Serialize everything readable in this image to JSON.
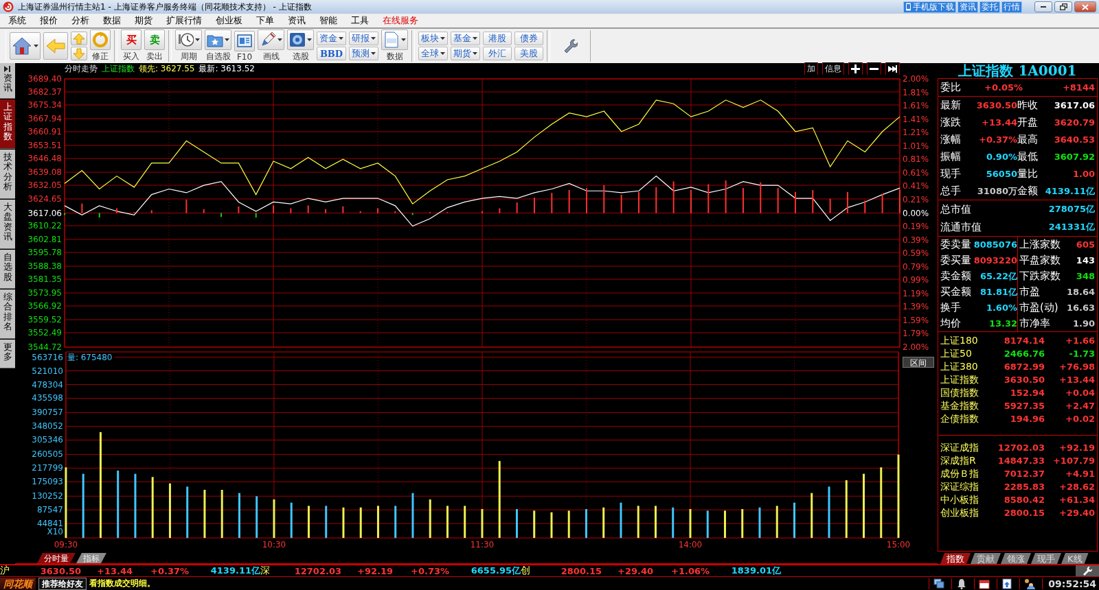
{
  "window": {
    "title": "上海证券温州行情主站1 - 上海证券客户服务终端（同花顺技术支持） - 上证指数",
    "links": [
      "手机版下载",
      "资讯",
      "委托",
      "行情"
    ]
  },
  "menu": [
    {
      "label": "系统",
      "highlighted": false
    },
    {
      "label": "报价",
      "highlighted": false
    },
    {
      "label": "分析",
      "highlighted": false
    },
    {
      "label": "数据",
      "highlighted": false
    },
    {
      "label": "期货",
      "highlighted": false
    },
    {
      "label": "扩展行情",
      "highlighted": false
    },
    {
      "label": "创业板",
      "highlighted": false
    },
    {
      "label": "下单",
      "highlighted": false
    },
    {
      "label": "资讯",
      "highlighted": false
    },
    {
      "label": "智能",
      "highlighted": false
    },
    {
      "label": "工具",
      "highlighted": false
    },
    {
      "label": "在线服务",
      "highlighted": true
    }
  ],
  "toolbar": {
    "refresh_label": "修正",
    "trade": [
      {
        "glyph": "买",
        "label": "买入",
        "color": "#e00000"
      },
      {
        "glyph": "卖",
        "label": "卖出",
        "color": "#0a9a0a"
      }
    ],
    "tools": [
      {
        "label": "周期",
        "dropdown": true
      },
      {
        "label": "自选股",
        "dropdown": true
      },
      {
        "label": "F10",
        "dropdown": false
      },
      {
        "label": "画线",
        "dropdown": true
      },
      {
        "label": "选股",
        "dropdown": true
      }
    ],
    "quick": [
      [
        {
          "label": "资金",
          "dropdown": true,
          "bold": false
        },
        {
          "label": "BBD",
          "dropdown": false,
          "bold": true
        }
      ],
      [
        {
          "label": "研报",
          "dropdown": true,
          "bold": false
        },
        {
          "label": "预测",
          "dropdown": true,
          "bold": false
        }
      ]
    ],
    "data_tool": {
      "label": "数据",
      "dropdown": true
    },
    "markets": [
      [
        {
          "label": "板块",
          "dropdown": true
        },
        {
          "label": "全球",
          "dropdown": true
        }
      ],
      [
        {
          "label": "基金",
          "dropdown": true
        },
        {
          "label": "期货",
          "dropdown": true
        }
      ],
      [
        {
          "label": "港股",
          "dropdown": false
        },
        {
          "label": "外汇",
          "dropdown": false
        }
      ],
      [
        {
          "label": "债券",
          "dropdown": false
        },
        {
          "label": "美股",
          "dropdown": false
        }
      ]
    ]
  },
  "side_tabs": [
    {
      "label": "资讯",
      "selected": false
    },
    {
      "label": "上证指数",
      "selected": true
    },
    {
      "label": "技术分析",
      "selected": false
    },
    {
      "label": "大盘资讯",
      "selected": false
    },
    {
      "label": "自选股",
      "selected": false
    },
    {
      "label": "综合排名",
      "selected": false
    },
    {
      "label": "更多",
      "selected": false
    }
  ],
  "chart": {
    "header": {
      "view": "分时走势",
      "symbol": "上证指数",
      "lead": "领先: 3627.55",
      "latest": "最新: 3613.52",
      "buttons": [
        "加",
        "信息"
      ]
    },
    "right_yticks": [
      "2.00%",
      "1.81%",
      "1.61%",
      "1.41%",
      "1.21%",
      "1.01%",
      "0.81%",
      "0.61%",
      "0.41%",
      "0.21%",
      "0.00%",
      "0.19%",
      "0.39%",
      "0.59%",
      "0.79%",
      "0.99%",
      "1.19%",
      "1.39%",
      "1.59%",
      "1.79%",
      "2.00%"
    ],
    "range_button": "区间",
    "chart_data": {
      "type": "line",
      "grid": true,
      "series": [
        {
          "color": "#ffffff",
          "values": [
            3621,
            3616,
            3621,
            3618,
            3616,
            3627,
            3630,
            3628,
            3632,
            3634,
            3623,
            3618,
            3623,
            3622,
            3625,
            3623,
            3625,
            3625,
            3625,
            3621,
            3610,
            3614,
            3620,
            3623,
            3625,
            3626,
            3625,
            3628,
            3630,
            3633,
            3629,
            3629,
            3628,
            3629,
            3637,
            3629,
            3631,
            3628,
            3630,
            3634,
            3632,
            3632,
            3625,
            3625,
            3613,
            3620,
            3623,
            3627,
            3630.5
          ]
        },
        {
          "color": "#ffff40",
          "values": [
            3633,
            3640,
            3630,
            3637,
            3631,
            3644,
            3644,
            3656,
            3650,
            3644,
            3644,
            3627,
            3645,
            3641,
            3647,
            3641,
            3646,
            3641,
            3644,
            3637,
            3622,
            3629,
            3635,
            3637,
            3641,
            3645,
            3650,
            3658,
            3665,
            3671,
            3669,
            3672,
            3661,
            3665,
            3678,
            3676,
            3669,
            3672,
            3678,
            3674,
            3678,
            3672,
            3661,
            3663,
            3642,
            3656,
            3650,
            3661,
            3669
          ]
        }
      ],
      "ylim": [
        3544.72,
        3689.4
      ],
      "yticks": [
        {
          "value": 3689.4,
          "label": "3689.40"
        },
        {
          "value": 3682.37,
          "label": "3682.37"
        },
        {
          "value": 3675.34,
          "label": "3675.34"
        },
        {
          "value": 3667.94,
          "label": "3667.94"
        },
        {
          "value": 3660.91,
          "label": "3660.91"
        },
        {
          "value": 3653.51,
          "label": "3653.51"
        },
        {
          "value": 3646.48,
          "label": "3646.48"
        },
        {
          "value": 3639.08,
          "label": "3639.08"
        },
        {
          "value": 3632.05,
          "label": "3632.05"
        },
        {
          "value": 3624.65,
          "label": "3624.65"
        },
        {
          "value": 3617.06,
          "label": "3617.06"
        },
        {
          "value": 3610.22,
          "label": "3610.22"
        },
        {
          "value": 3602.81,
          "label": "3602.81"
        },
        {
          "value": 3595.78,
          "label": "3595.78"
        },
        {
          "value": 3588.38,
          "label": "3588.38"
        },
        {
          "value": 3581.35,
          "label": "3581.35"
        },
        {
          "value": 3573.95,
          "label": "3573.95"
        },
        {
          "value": 3566.92,
          "label": "3566.92"
        },
        {
          "value": 3559.52,
          "label": "3559.52"
        },
        {
          "value": 3552.49,
          "label": "3552.49"
        },
        {
          "value": 3544.72,
          "label": "3544.72"
        }
      ]
    },
    "volume": {
      "title": "量: 675480",
      "unit_label": "X10",
      "chart_data": {
        "type": "bar",
        "grid": true,
        "categories": [
          "09:30",
          null,
          null,
          null,
          null,
          null,
          null,
          null,
          null,
          null,
          null,
          null,
          "10:30",
          null,
          null,
          null,
          null,
          null,
          null,
          null,
          null,
          null,
          null,
          null,
          "11:30",
          null,
          null,
          null,
          null,
          null,
          null,
          null,
          null,
          null,
          null,
          null,
          "14:00",
          null,
          null,
          null,
          null,
          null,
          null,
          null,
          null,
          null,
          null,
          null,
          "15:00"
        ],
        "values": [
          220000,
          200000,
          330000,
          210000,
          200000,
          190000,
          170000,
          160000,
          150000,
          150000,
          140000,
          130000,
          120000,
          110000,
          100000,
          100000,
          95000,
          95000,
          100000,
          100000,
          140000,
          120000,
          100000,
          100000,
          90000,
          240000,
          90000,
          85000,
          80000,
          85000,
          90000,
          95000,
          110000,
          100000,
          100000,
          95000,
          90000,
          85000,
          85000,
          90000,
          95000,
          100000,
          110000,
          140000,
          160000,
          180000,
          200000,
          220000,
          260000
        ],
        "ylim": [
          0,
          580000
        ],
        "yticks": [
          563716,
          521010,
          478304,
          435598,
          390757,
          348052,
          305346,
          260505,
          217799,
          175093,
          130252,
          87547,
          44841
        ]
      }
    },
    "tabs": [
      {
        "label": "分时量",
        "selected": true
      },
      {
        "label": "指标",
        "selected": false
      }
    ]
  },
  "panel": {
    "title": "上证指数 1A0001",
    "commission": {
      "label": "委比",
      "ratio": "+0.05%",
      "diff": "+8144"
    },
    "quote": [
      {
        "cells": [
          {
            "label": "最新",
            "value": "3630.50",
            "color": "#ff3434"
          },
          {
            "label": "昨收",
            "value": "3617.06",
            "color": "#ffffff"
          }
        ]
      },
      {
        "cells": [
          {
            "label": "涨跌",
            "value": "+13.44",
            "color": "#ff3434"
          },
          {
            "label": "开盘",
            "value": "3620.79",
            "color": "#ff3434"
          }
        ]
      },
      {
        "cells": [
          {
            "label": "涨幅",
            "value": "+0.37%",
            "color": "#ff3434"
          },
          {
            "label": "最高",
            "value": "3640.53",
            "color": "#ff3434"
          }
        ]
      },
      {
        "cells": [
          {
            "label": "振幅",
            "value": "0.90%",
            "color": "#20d8ff"
          },
          {
            "label": "最低",
            "value": "3607.92",
            "color": "#10e010"
          }
        ]
      },
      {
        "cells": [
          {
            "label": "现手",
            "value": "56050",
            "color": "#20d8ff"
          },
          {
            "label": "量比",
            "value": "1.00",
            "color": "#ff3434"
          }
        ]
      },
      {
        "cells": [
          {
            "label": "总手",
            "value": "31080万",
            "color": "#c8c8c8"
          },
          {
            "label": "金额",
            "value": "4139.11亿",
            "color": "#20d8ff"
          }
        ]
      }
    ],
    "market_value": [
      {
        "label": "总市值",
        "value": "278075亿",
        "color": "#20d8ff"
      },
      {
        "label": "流通市值",
        "value": "241331亿",
        "color": "#20d8ff"
      }
    ],
    "orders": [
      {
        "cells": [
          {
            "label": "委卖量",
            "value": "8085076",
            "color": "#20d8ff"
          },
          {
            "label": "上涨家数",
            "value": "605",
            "color": "#ff3434"
          }
        ]
      },
      {
        "cells": [
          {
            "label": "委买量",
            "value": "8093220",
            "color": "#ff3434"
          },
          {
            "label": "平盘家数",
            "value": "143",
            "color": "#ffffff"
          }
        ]
      },
      {
        "cells": [
          {
            "label": "卖金额",
            "value": "65.22亿",
            "color": "#20d8ff"
          },
          {
            "label": "下跌家数",
            "value": "348",
            "color": "#10e010"
          }
        ]
      },
      {
        "cells": [
          {
            "label": "买金额",
            "value": "81.81亿",
            "color": "#20d8ff"
          },
          {
            "label": "市盈",
            "value": "18.64",
            "color": "#c8c8c8"
          }
        ]
      },
      {
        "cells": [
          {
            "label": "换手",
            "value": "1.60%",
            "color": "#20d8ff"
          },
          {
            "label": "市盈(动)",
            "value": "16.63",
            "color": "#c8c8c8"
          }
        ]
      },
      {
        "cells": [
          {
            "label": "均价",
            "value": "13.32",
            "color": "#10e010"
          },
          {
            "label": "市净率",
            "value": "1.90",
            "color": "#c8c8c8"
          }
        ]
      }
    ],
    "sh_indices": [
      {
        "name": "上证180",
        "value": "8174.14",
        "change": "+1.66",
        "color": "#ff3434"
      },
      {
        "name": "上证50",
        "value": "2466.76",
        "change": "-1.73",
        "color": "#10e010"
      },
      {
        "name": "上证380",
        "value": "6872.99",
        "change": "+76.98",
        "color": "#ff3434"
      },
      {
        "name": "上证指数",
        "value": "3630.50",
        "change": "+13.44",
        "color": "#ff3434"
      },
      {
        "name": "国债指数",
        "value": "152.94",
        "change": "+0.04",
        "color": "#ff3434"
      },
      {
        "name": "基金指数",
        "value": "5927.35",
        "change": "+2.47",
        "color": "#ff3434"
      },
      {
        "name": "企债指数",
        "value": "194.96",
        "change": "+0.02",
        "color": "#ff3434"
      }
    ],
    "sz_indices": [
      {
        "name": "深证成指",
        "value": "12702.03",
        "change": "+92.19",
        "color": "#ff3434"
      },
      {
        "name": "深成指R",
        "value": "14847.33",
        "change": "+107.79",
        "color": "#ff3434"
      },
      {
        "name": "成份Ｂ指",
        "value": "7012.37",
        "change": "+4.91",
        "color": "#ff3434"
      },
      {
        "name": "深证综指",
        "value": "2285.83",
        "change": "+28.62",
        "color": "#ff3434"
      },
      {
        "name": "中小板指",
        "value": "8580.42",
        "change": "+61.34",
        "color": "#ff3434"
      },
      {
        "name": "创业板指",
        "value": "2800.15",
        "change": "+29.40",
        "color": "#ff3434"
      }
    ],
    "tabs": [
      {
        "label": "指数",
        "selected": true
      },
      {
        "label": "贡献",
        "selected": false
      },
      {
        "label": "领涨",
        "selected": false
      },
      {
        "label": "现手",
        "selected": false
      },
      {
        "label": "K线",
        "selected": false
      }
    ]
  },
  "ticker": [
    {
      "market": "沪",
      "price": "3630.50",
      "change": "+13.44",
      "percent": "+0.37%",
      "amount": "4139.11亿"
    },
    {
      "market": "深",
      "price": "12702.03",
      "change": "+92.19",
      "percent": "+0.73%",
      "amount": "6655.95亿"
    },
    {
      "market": "创",
      "price": "2800.15",
      "change": "+29.40",
      "percent": "+1.06%",
      "amount": "1839.01亿"
    }
  ],
  "status": {
    "logo": "同花顺",
    "share": "推荐给好友",
    "message": "看指数成交明细。",
    "time": "09:52:54"
  }
}
